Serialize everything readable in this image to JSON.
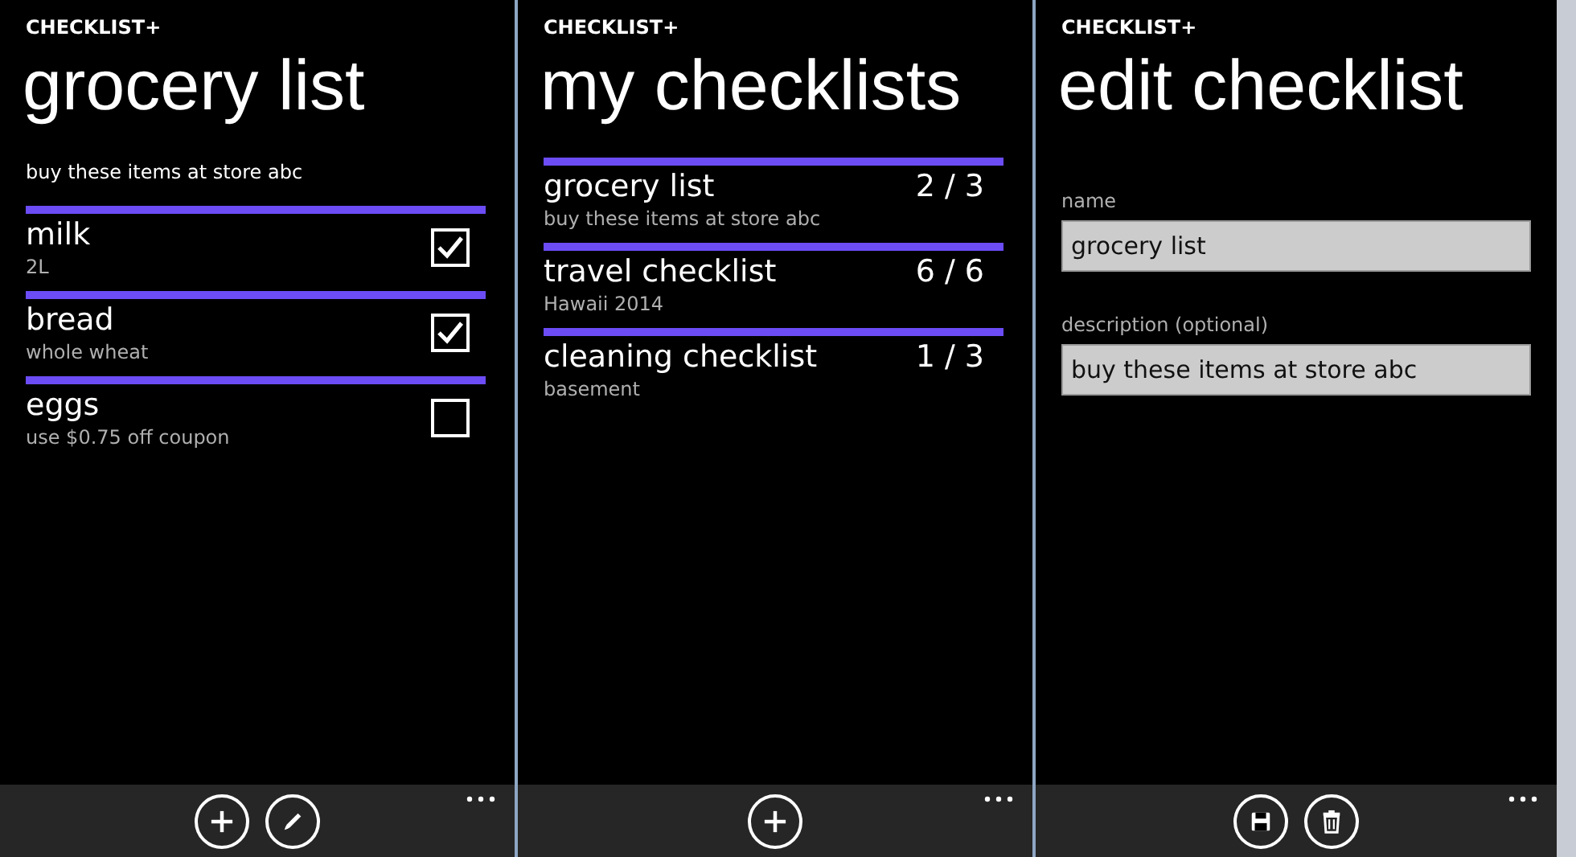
{
  "screens": [
    {
      "kind": "items",
      "app_name": "CHECKLIST+",
      "title": "grocery list",
      "subtitle": "buy these items at store abc",
      "items": [
        {
          "name": "milk",
          "note": "2L",
          "checked": true
        },
        {
          "name": "bread",
          "note": "whole wheat",
          "checked": true
        },
        {
          "name": "eggs",
          "note": "use $0.75 off coupon",
          "checked": false
        }
      ],
      "app_bar": [
        {
          "kind": "add"
        },
        {
          "kind": "edit"
        }
      ]
    },
    {
      "kind": "lists",
      "app_name": "CHECKLIST+",
      "title": "my checklists",
      "lists": [
        {
          "name": "grocery list",
          "description": "buy these items at store abc",
          "count": "2 / 3"
        },
        {
          "name": "travel checklist",
          "description": "Hawaii 2014",
          "count": "6 / 6"
        },
        {
          "name": "cleaning checklist",
          "description": "basement",
          "count": "1 / 3"
        }
      ],
      "app_bar": [
        {
          "kind": "add"
        }
      ]
    },
    {
      "kind": "form",
      "app_name": "CHECKLIST+",
      "title": "edit checklist",
      "fields": [
        {
          "label": "name",
          "value": "grocery list"
        },
        {
          "label": "description (optional)",
          "value": "buy these items at store abc"
        }
      ],
      "app_bar": [
        {
          "kind": "save"
        },
        {
          "kind": "delete"
        }
      ]
    }
  ]
}
